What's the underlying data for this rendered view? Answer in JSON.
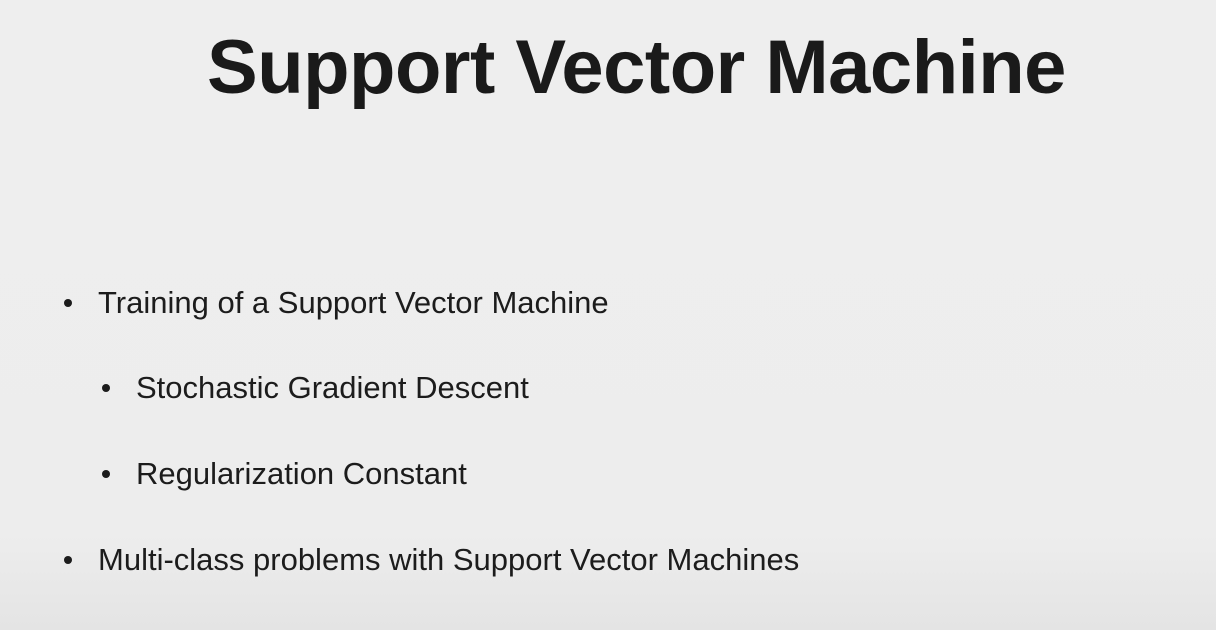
{
  "slide": {
    "title": "Support Vector Machine",
    "bullets": [
      {
        "level": 1,
        "text": "Training of a Support Vector Machine"
      },
      {
        "level": 2,
        "text": "Stochastic Gradient Descent"
      },
      {
        "level": 2,
        "text": "Regularization Constant"
      },
      {
        "level": 1,
        "text": "Multi-class problems with Support Vector Machines"
      }
    ]
  },
  "colors": {
    "background": "#ededed",
    "text": "#1c1c1c"
  }
}
